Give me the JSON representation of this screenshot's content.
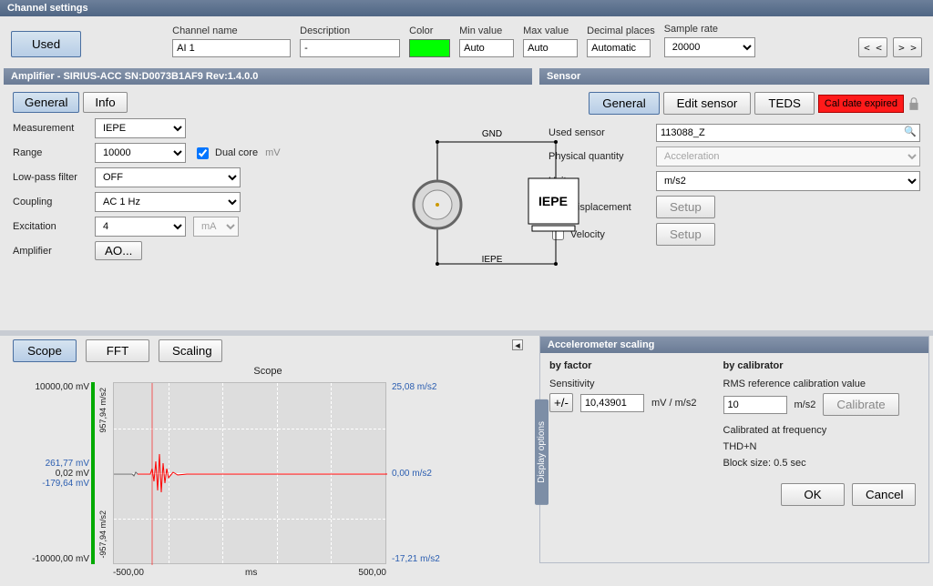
{
  "window_title": "Channel settings",
  "top": {
    "used_btn": "Used",
    "channel_name_lbl": "Channel name",
    "channel_name_val": "AI 1",
    "description_lbl": "Description",
    "description_val": "-",
    "color_lbl": "Color",
    "color_val": "#00ff00",
    "min_lbl": "Min value",
    "min_val": "Auto",
    "max_lbl": "Max value",
    "max_val": "Auto",
    "decimals_lbl": "Decimal places",
    "decimals_val": "Automatic",
    "sample_lbl": "Sample rate",
    "sample_val": "20000",
    "prev": "< <",
    "next": "> >"
  },
  "amp": {
    "header": "Amplifier - SIRIUS-ACC SN:D0073B1AF9 Rev:1.4.0.0",
    "tab_general": "General",
    "tab_info": "Info",
    "measurement_lbl": "Measurement",
    "measurement_val": "IEPE",
    "range_lbl": "Range",
    "range_val": "10000",
    "dualcore_lbl": "Dual core",
    "range_unit": "mV",
    "lpf_lbl": "Low-pass filter",
    "lpf_val": "OFF",
    "coupling_lbl": "Coupling",
    "coupling_val": "AC  1 Hz",
    "excitation_lbl": "Excitation",
    "excitation_val": "4",
    "excitation_unit": "mA",
    "amplifier_lbl": "Amplifier",
    "amplifier_btn": "AO...",
    "diagram_gnd": "GND",
    "diagram_iepe_box": "IEPE",
    "diagram_iepe_bot": "IEPE"
  },
  "sensor": {
    "header": "Sensor",
    "tab_general": "General",
    "tab_edit": "Edit sensor",
    "tab_teds": "TEDS",
    "badge": "Cal date expired",
    "used_sensor_lbl": "Used sensor",
    "used_sensor_val": "113088_Z",
    "phys_lbl": "Physical quantity",
    "phys_val": "Acceleration",
    "unit_lbl": "Unit",
    "unit_val": "m/s2",
    "disp_lbl": "Displacement",
    "vel_lbl": "Velocity",
    "setup_btn": "Setup"
  },
  "scope": {
    "tab_scope": "Scope",
    "tab_fft": "FFT",
    "tab_scaling": "Scaling",
    "title": "Scope",
    "y_top": "10000,00 mV",
    "y_bot": "-10000,00 mV",
    "left_vert_top": "957,94 m/s2",
    "left_vert_bot": "-957,94 m/s2",
    "cursor_blue": "261,77 mV",
    "cursor_black": "0,02 mV",
    "cursor_blue2": "-179,64 mV",
    "right_top": "25,08 m/s2",
    "right_mid": "0,00 m/s2",
    "right_bot": "-17,21 m/s2",
    "x_left": "-500,00",
    "x_unit": "ms",
    "x_right": "500,00",
    "display_options": "Display options"
  },
  "scaling": {
    "header": "Accelerometer scaling",
    "by_factor": "by factor",
    "by_calibrator": "by calibrator",
    "sensitivity_lbl": "Sensitivity",
    "toggle": "+/-",
    "sensitivity_val": "10,43901",
    "sensitivity_unit": "mV / m/s2",
    "rms_lbl": "RMS reference calibration value",
    "rms_val": "10",
    "rms_unit": "m/s2",
    "calibrate_btn": "Calibrate",
    "calib_freq": "Calibrated at frequency",
    "thd": "THD+N",
    "block": "Block size: 0.5 sec"
  },
  "footer": {
    "ok": "OK",
    "cancel": "Cancel"
  },
  "chart_data": {
    "type": "line",
    "title": "Scope",
    "xlabel": "ms",
    "x": [
      -500,
      500
    ],
    "y_left": {
      "label": "mV",
      "lim": [
        -10000,
        10000
      ]
    },
    "y_right": {
      "label": "m/s2",
      "lim": [
        -957.94,
        957.94
      ]
    },
    "cursor_values_mV": [
      261.77,
      0.02,
      -179.64
    ],
    "cursor_values_ms2": [
      25.08,
      0.0,
      -17.21
    ],
    "series": [
      {
        "name": "signal",
        "color": "#ff0000",
        "x": [
          -500,
          -430,
          -420,
          -400,
          -380,
          -370,
          -360,
          -350,
          -340,
          -330,
          -320,
          -300,
          -280,
          -250,
          -220,
          -200,
          -100,
          0,
          100,
          200,
          300,
          400,
          500
        ],
        "y_mV": [
          0,
          0,
          30,
          -60,
          120,
          -180,
          261,
          -180,
          140,
          -90,
          60,
          30,
          20,
          10,
          5,
          3,
          0,
          0,
          0,
          0,
          0,
          0,
          0
        ]
      }
    ]
  }
}
